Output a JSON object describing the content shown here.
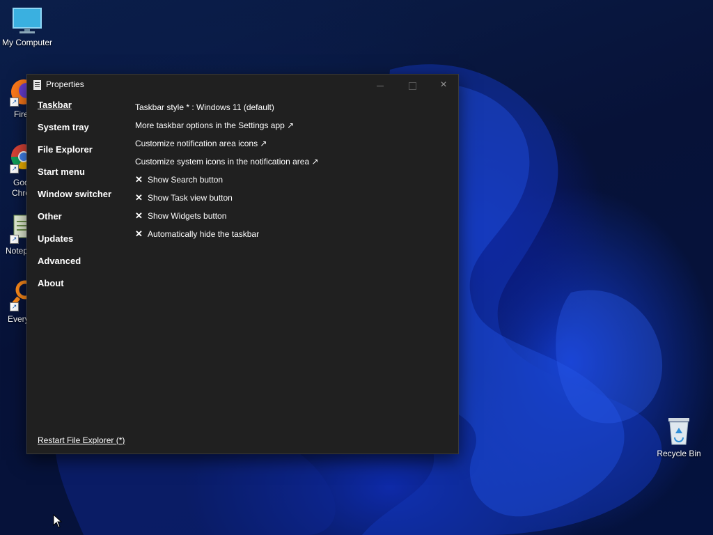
{
  "desktop": {
    "icons": [
      {
        "label": "My Computer",
        "icon": "monitor-icon"
      },
      {
        "label": "Recycle Bin",
        "icon": "recycle-bin-icon"
      }
    ],
    "partial_labels": [
      "Fire",
      "Goo",
      "Chro",
      "Notep",
      "Every"
    ]
  },
  "window": {
    "title": "Properties",
    "controls": {
      "minimize": "minimize",
      "maximize": "maximize",
      "close": "×"
    },
    "nav": [
      {
        "label": "Taskbar",
        "active": true
      },
      {
        "label": "System tray"
      },
      {
        "label": "File Explorer"
      },
      {
        "label": "Start menu"
      },
      {
        "label": "Window switcher"
      },
      {
        "label": "Other"
      },
      {
        "label": "Updates"
      },
      {
        "label": "Advanced"
      },
      {
        "label": "About"
      }
    ],
    "content": {
      "taskbar_style": "Taskbar style * : Windows 11 (default)",
      "links": [
        "More taskbar options in the Settings app ↗",
        "Customize notification area icons ↗",
        "Customize system icons in the notification area ↗"
      ],
      "checks": [
        {
          "mark": "✕",
          "label": "Show Search button"
        },
        {
          "mark": "✕",
          "label": "Show Task view button"
        },
        {
          "mark": "✕",
          "label": "Show Widgets button"
        },
        {
          "mark": "✕",
          "label": "Automatically hide the taskbar"
        }
      ]
    },
    "footer_link": "Restart File Explorer (*)"
  },
  "colors": {
    "window_bg": "#202020",
    "text": "#ffffff",
    "accent_blue": "#1238c8"
  }
}
